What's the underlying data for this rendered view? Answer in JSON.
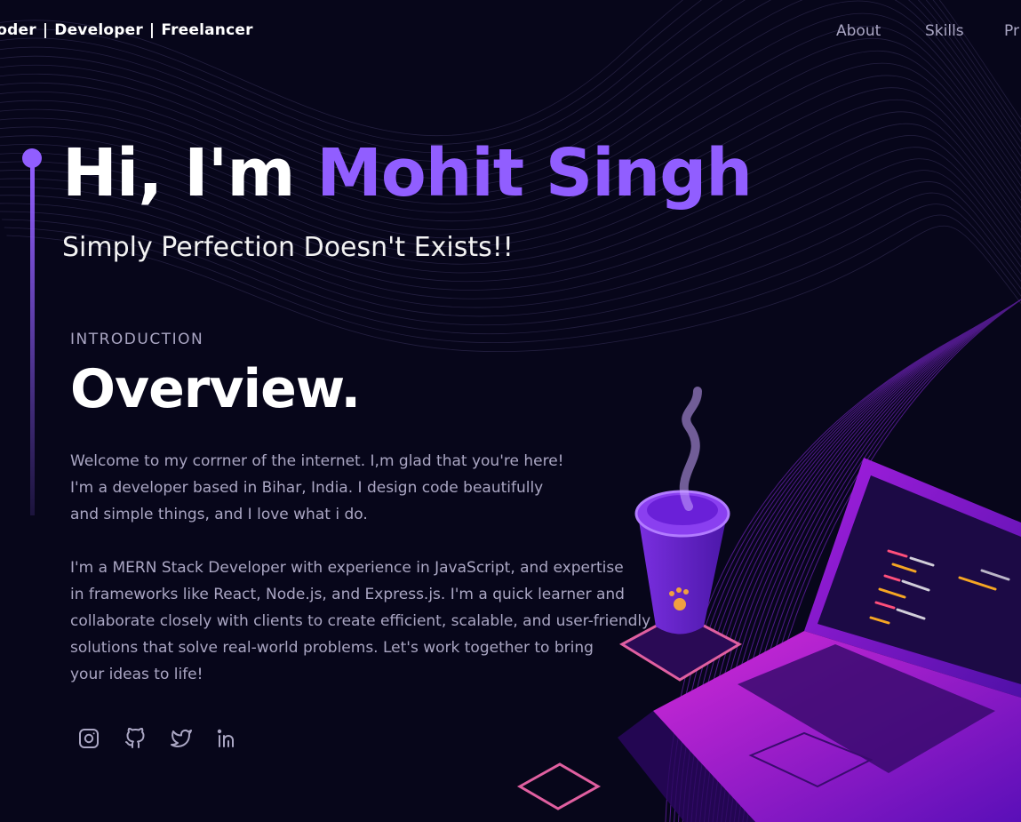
{
  "nav": {
    "brand": [
      "coder",
      "Developer",
      "Freelancer"
    ],
    "brand_separator": "|",
    "links": [
      "About",
      "Skills",
      "Pr"
    ]
  },
  "hero": {
    "greeting": "Hi, I'm ",
    "name": "Mohit Singh",
    "tagline": "Simply Perfection Doesn't Exists!!"
  },
  "overview": {
    "subtitle": "INTRODUCTION",
    "title": "Overview.",
    "paragraph1": "Welcome to my corrner of the internet. I,m glad that you're here!\nI'm a developer based in Bihar, India. I design code beautifully\nand simple things, and I love what i do.",
    "paragraph2": "I'm a MERN Stack Developer with experience in JavaScript, and expertise\nin frameworks like React, Node.js, and Express.js. I'm a quick learner and\ncollaborate closely with clients to create efficient, scalable, and user-friendly\nsolutions that solve real-world problems. Let's work together to bring\nyour ideas to life!"
  },
  "socials": [
    "instagram-icon",
    "github-icon",
    "twitter-icon",
    "linkedin-icon"
  ],
  "colors": {
    "background": "#07061a",
    "accent": "#915eff",
    "secondary_text": "#aaa6c3",
    "primary_text": "#ffffff"
  }
}
